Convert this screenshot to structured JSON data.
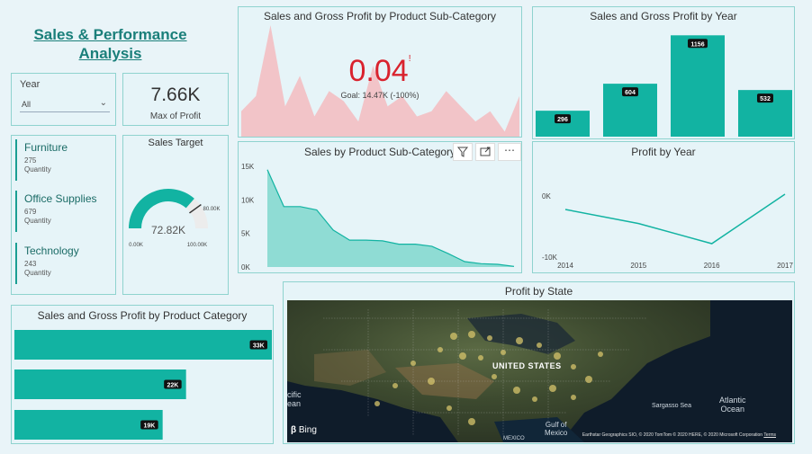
{
  "header": {
    "title_line1": "Sales & Performance",
    "title_line2": "Analysis"
  },
  "year_slicer": {
    "label": "Year",
    "value": "All"
  },
  "kpi_profit": {
    "value": "7.66K",
    "label": "Max of Profit"
  },
  "categories_card": {
    "items": [
      {
        "name": "Furniture",
        "qty": "275",
        "qty_label": "Quantity"
      },
      {
        "name": "Office Supplies",
        "qty": "679",
        "qty_label": "Quantity"
      },
      {
        "name": "Technology",
        "qty": "243",
        "qty_label": "Quantity"
      }
    ]
  },
  "sales_target": {
    "title": "Sales Target",
    "value": "72.82K",
    "min": "0.00K",
    "max": "100.00K",
    "target": "80.00K",
    "fill_fraction": 0.728,
    "target_fraction": 0.8
  },
  "subcat_area": {
    "title": "Sales and Gross Profit by Product Sub-Category",
    "kpi_value": "0.04",
    "kpi_mark": "!",
    "goal_text": "Goal: 14.47K (-100%)"
  },
  "year_bars": {
    "title": "Sales and Gross Profit by Year"
  },
  "sales_subcat": {
    "title": "Sales by Product Sub-Category"
  },
  "profit_year": {
    "title": "Profit by Year"
  },
  "cat_bars": {
    "title": "Sales and Gross Profit by Product Category"
  },
  "map": {
    "title": "Profit by State",
    "country_label": "UNITED STATES",
    "gulf_label_1": "Gulf of",
    "gulf_label_2": "Mexico",
    "sargasso": "Sargasso Sea",
    "atlantic_1": "Atlantic",
    "atlantic_2": "Ocean",
    "pacific_1": "cific",
    "pacific_2": "ean",
    "mexico": "MEXICO",
    "bing": "Bing",
    "attribution": "Earthstar Geographics SIO, © 2020 TomTom © 2020 HERE, © 2020 Microsoft Corporation",
    "terms": "Terms"
  },
  "colors": {
    "accent": "#12b3a2",
    "area_pink": "#f2c4c8",
    "kpi_red": "#d9232e",
    "panel_bg": "#e6f4f8",
    "title_teal": "#1a7f7a"
  },
  "chart_data": [
    {
      "type": "area",
      "title": "Sales and Gross Profit by Product Sub-Category",
      "values": [
        5,
        8,
        22,
        6,
        12,
        4,
        9,
        7,
        3,
        14,
        6,
        8,
        4,
        5,
        9,
        6,
        3,
        5,
        1,
        8
      ],
      "series": [
        {
          "name": "",
          "values": [
            5,
            8,
            22,
            6,
            12,
            4,
            9,
            7,
            3,
            14,
            6,
            8,
            4,
            5,
            9,
            6,
            3,
            5,
            1,
            8
          ]
        }
      ]
    },
    {
      "type": "bar",
      "title": "Sales and Gross Profit by Year",
      "categories": [
        "2014",
        "2015",
        "2016",
        "2017"
      ],
      "values": [
        296,
        604,
        1156,
        532
      ],
      "labels": [
        "296",
        "604",
        "1156",
        "532"
      ],
      "ylim": [
        0,
        1200
      ]
    },
    {
      "type": "area",
      "title": "Sales by Product Sub-Category",
      "values": [
        14.5,
        9.0,
        9.0,
        8.5,
        5.5,
        4.0,
        4.0,
        3.9,
        3.4,
        3.4,
        3.1,
        2.0,
        0.8,
        0.5,
        0.4,
        0.1
      ],
      "yticks": [
        "15K",
        "10K",
        "5K",
        "0K"
      ],
      "ylim": [
        0,
        15
      ]
    },
    {
      "type": "line",
      "title": "Profit by Year",
      "x": [
        "2014",
        "2015",
        "2016",
        "2017"
      ],
      "values": [
        -2.2,
        -4.5,
        -7.8,
        0.3
      ],
      "yticks": [
        "0K",
        "-10K"
      ],
      "ylim": [
        -10,
        0
      ]
    },
    {
      "type": "bar",
      "title": "Sales and Gross Profit by Product Category",
      "categories": [
        "",
        "",
        ""
      ],
      "values": [
        33,
        22,
        19
      ],
      "labels": [
        "33K",
        "22K",
        "19K"
      ],
      "xlim": [
        0,
        33
      ]
    }
  ]
}
